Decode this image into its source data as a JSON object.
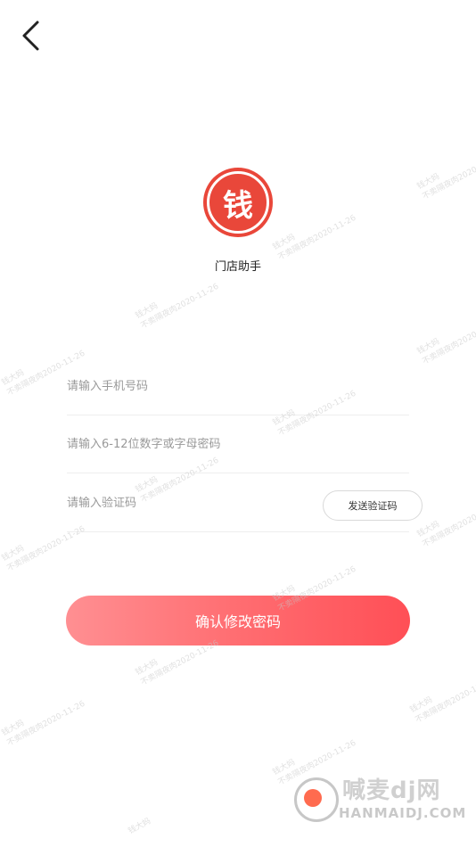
{
  "header": {
    "back_icon": "chevron-left-icon"
  },
  "logo": {
    "char": "钱",
    "color": "#e9473a"
  },
  "app_name": "门店助手",
  "form": {
    "phone_placeholder": "请输入手机号码",
    "password_placeholder": "请输入6-12位数字或字母密码",
    "code_placeholder": "请输入验证码",
    "send_code_label": "发送验证码"
  },
  "confirm_button": {
    "label": "确认修改密码",
    "gradient_start": "#ff8f92",
    "gradient_end": "#ff4f56"
  },
  "watermark": {
    "line1": "钱大妈",
    "line2": "不卖隔夜肉2020-11-26"
  },
  "brand": {
    "name": "喊麦dj网",
    "domain": "HANMAIDJ.COM"
  }
}
